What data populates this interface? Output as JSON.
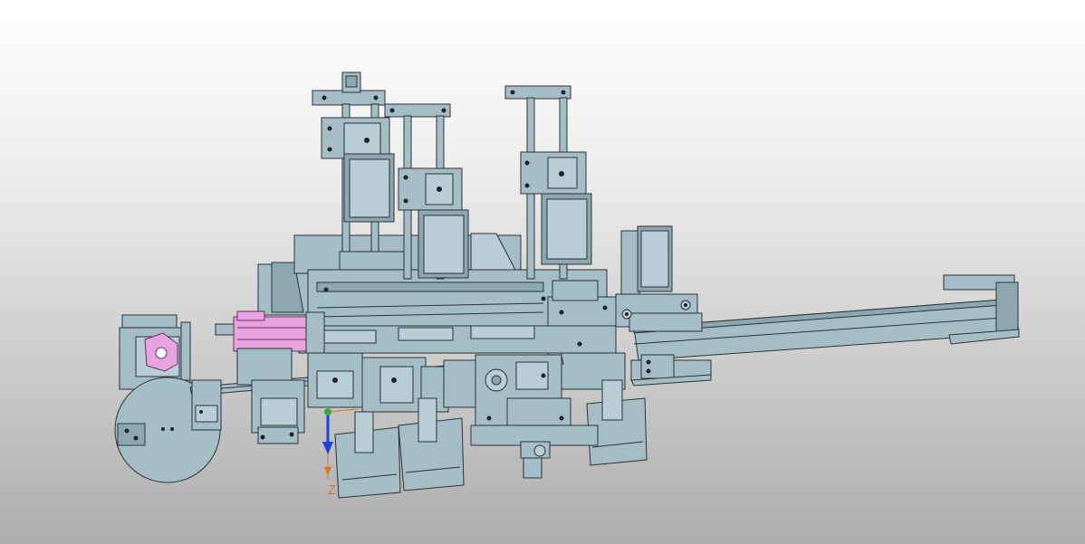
{
  "viewport": {
    "background_top": "#ffffff",
    "background_bottom": "#adadad",
    "model_color": "#a5bec6",
    "highlight_color": "#e6a3de"
  },
  "triad": {
    "axis_z_label": "Z",
    "axis_z_color": "#d47a22",
    "axis_arrow_color": "#1f3fd6"
  }
}
